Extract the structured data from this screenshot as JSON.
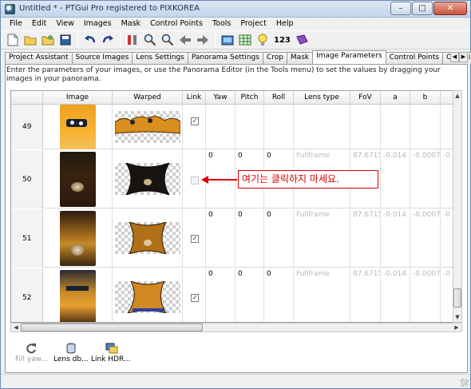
{
  "window": {
    "title": "Untitled * - PTGui Pro registered to PIXKOREA",
    "buttons": [
      "–",
      "□",
      "✕"
    ]
  },
  "menubar": [
    "File",
    "Edit",
    "View",
    "Images",
    "Mask",
    "Control Points",
    "Tools",
    "Project",
    "Help"
  ],
  "toolbar": {
    "count_label": "123"
  },
  "tabs": [
    {
      "label": "Project Assistant",
      "active": false
    },
    {
      "label": "Source Images",
      "active": false
    },
    {
      "label": "Lens Settings",
      "active": false
    },
    {
      "label": "Panorama Settings",
      "active": false
    },
    {
      "label": "Crop",
      "active": false
    },
    {
      "label": "Mask",
      "active": false
    },
    {
      "label": "Image Parameters",
      "active": true
    },
    {
      "label": "Control Points",
      "active": false
    },
    {
      "label": "Optimizer",
      "active": false
    }
  ],
  "instructions": "Enter the parameters of your images, or use the Panorama Editor (in the Tools menu) to set the values by dragging your images in your panorama.",
  "grid": {
    "columns": [
      "",
      "Image",
      "Warped",
      "Link",
      "Yaw",
      "Pitch",
      "Roll",
      "Lens type",
      "FoV",
      "a",
      "b",
      ""
    ],
    "rows": [
      {
        "num": "49",
        "link": true,
        "yaw": "",
        "pitch": "",
        "roll": "",
        "lens": "",
        "fov": "",
        "a": "",
        "b": "",
        "c": ""
      },
      {
        "num": "50",
        "link": false,
        "yaw": "0",
        "pitch": "0",
        "roll": "0",
        "lens": "Fullframe",
        "fov": "87.6715",
        "a": "-0.014",
        "b": "-0.0007",
        "c": "-0"
      },
      {
        "num": "51",
        "link": true,
        "yaw": "0",
        "pitch": "0",
        "roll": "0",
        "lens": "Fullframe",
        "fov": "87.6715",
        "a": "-0.014",
        "b": "-0.0007",
        "c": "-0"
      },
      {
        "num": "52",
        "link": true,
        "yaw": "0",
        "pitch": "0",
        "roll": "0",
        "lens": "Fullframe",
        "fov": "87.6715",
        "a": "-0.014",
        "b": "-0.0007",
        "c": "-0"
      }
    ]
  },
  "annotation": "여기는 클릭하지 마세요.",
  "bottom_buttons": [
    {
      "label": "Fill yaw...",
      "enabled": false,
      "icon": "refresh-icon"
    },
    {
      "label": "Lens db...",
      "enabled": true,
      "icon": "database-icon"
    },
    {
      "label": "Link HDR...",
      "enabled": true,
      "icon": "link-hdr-icon"
    }
  ],
  "colors": {
    "annotation_red": "#dd0000",
    "dim_text": "#b8b8b8"
  }
}
